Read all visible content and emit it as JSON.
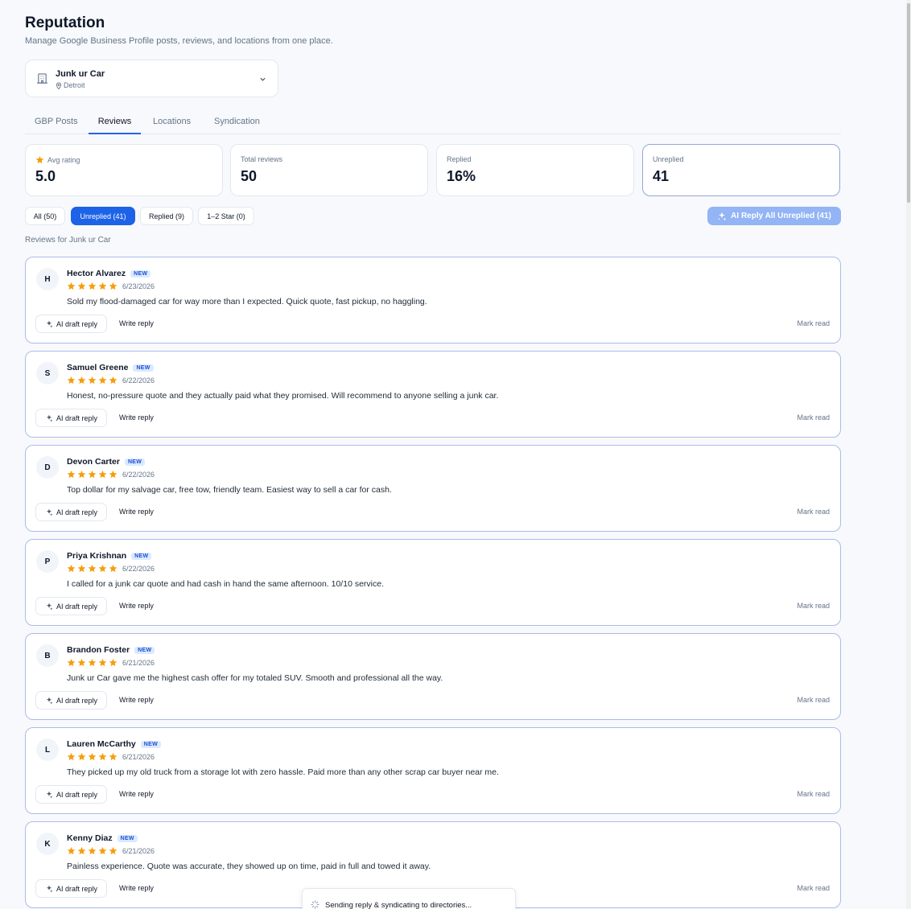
{
  "header": {
    "title": "Reputation",
    "subtitle": "Manage Google Business Profile posts, reviews, and locations from one place."
  },
  "business": {
    "name": "Junk ur Car",
    "location": "Detroit"
  },
  "tabs": [
    {
      "label": "GBP Posts"
    },
    {
      "label": "Reviews",
      "active": true
    },
    {
      "label": "Locations"
    },
    {
      "label": "Syndication"
    }
  ],
  "stats": [
    {
      "label": "Avg rating",
      "value": "5.0",
      "icon": "star-icon"
    },
    {
      "label": "Total reviews",
      "value": "50"
    },
    {
      "label": "Replied",
      "value": "16%"
    },
    {
      "label": "Unreplied",
      "value": "41"
    }
  ],
  "filters": [
    {
      "label": "All (50)"
    },
    {
      "label": "Unreplied (41)",
      "active": true
    },
    {
      "label": "Replied (9)"
    },
    {
      "label": "1–2 Star (0)"
    }
  ],
  "ai_reply_all": {
    "label": "AI Reply All Unreplied (41)"
  },
  "section_label": "Reviews for Junk ur Car",
  "review_actions": {
    "badge": "NEW",
    "ai_draft": "AI draft reply",
    "write_reply": "Write reply",
    "mark_read": "Mark read"
  },
  "reviews": [
    {
      "initial": "H",
      "name": "Hector Alvarez",
      "rating": 5,
      "date": "6/23/2026",
      "text": "Sold my flood-damaged car for way more than I expected. Quick quote, fast pickup, no haggling."
    },
    {
      "initial": "S",
      "name": "Samuel Greene",
      "rating": 5,
      "date": "6/22/2026",
      "text": "Honest, no-pressure quote and they actually paid what they promised. Will recommend to anyone selling a junk car."
    },
    {
      "initial": "D",
      "name": "Devon Carter",
      "rating": 5,
      "date": "6/22/2026",
      "text": "Top dollar for my salvage car, free tow, friendly team. Easiest way to sell a car for cash."
    },
    {
      "initial": "P",
      "name": "Priya Krishnan",
      "rating": 5,
      "date": "6/22/2026",
      "text": "I called for a junk car quote and had cash in hand the same afternoon. 10/10 service."
    },
    {
      "initial": "B",
      "name": "Brandon Foster",
      "rating": 5,
      "date": "6/21/2026",
      "text": "Junk ur Car gave me the highest cash offer for my totaled SUV. Smooth and professional all the way."
    },
    {
      "initial": "L",
      "name": "Lauren McCarthy",
      "rating": 5,
      "date": "6/21/2026",
      "text": "They picked up my old truck from a storage lot with zero hassle. Paid more than any other scrap car buyer near me."
    },
    {
      "initial": "K",
      "name": "Kenny Diaz",
      "rating": 5,
      "date": "6/21/2026",
      "text": "Painless experience. Quote was accurate, they showed up on time, paid in full and towed it away."
    }
  ],
  "toast": {
    "text": "Sending reply & syndicating to directories..."
  },
  "colors": {
    "accent": "#1d63e8",
    "star": "#f59e0b",
    "card_border": "#a9bde6"
  }
}
